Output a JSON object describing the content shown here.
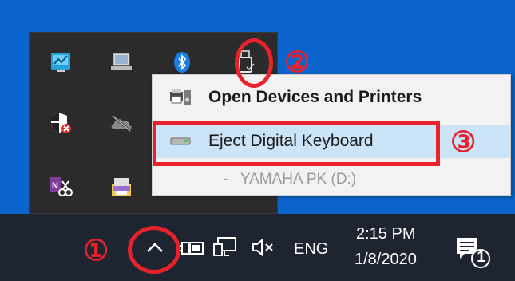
{
  "context_menu": {
    "open_devices_label": "Open Devices and Printers",
    "eject_label": "Eject Digital Keyboard",
    "drive_label": "-   YAMAHA PK (D:)"
  },
  "taskbar": {
    "language": "ENG",
    "time": "2:15 PM",
    "date": "1/8/2020",
    "notification_count": "1"
  },
  "annotations": {
    "step1": "①",
    "step2": "②",
    "step3": "③"
  },
  "colors": {
    "desktop": "#0b64cb",
    "taskbar": "#1f2530",
    "flyout": "#2b2b2b",
    "menu_bg": "#f2f2f2",
    "menu_highlight": "#cce4f7",
    "annotation": "#e8212a"
  },
  "icons": {
    "tray_flyout": [
      "network-monitor-icon",
      "laptop-display-icon",
      "bluetooth-icon",
      "usb-drive-icon",
      "security-shield-icon",
      "cloud-offline-icon",
      "onenote-clip-icon",
      "printer-folder-icon"
    ],
    "taskbar": [
      "show-hidden-icons-chevron-icon",
      "battery-plug-icon",
      "network-icon",
      "volume-muted-icon",
      "action-center-icon"
    ]
  }
}
